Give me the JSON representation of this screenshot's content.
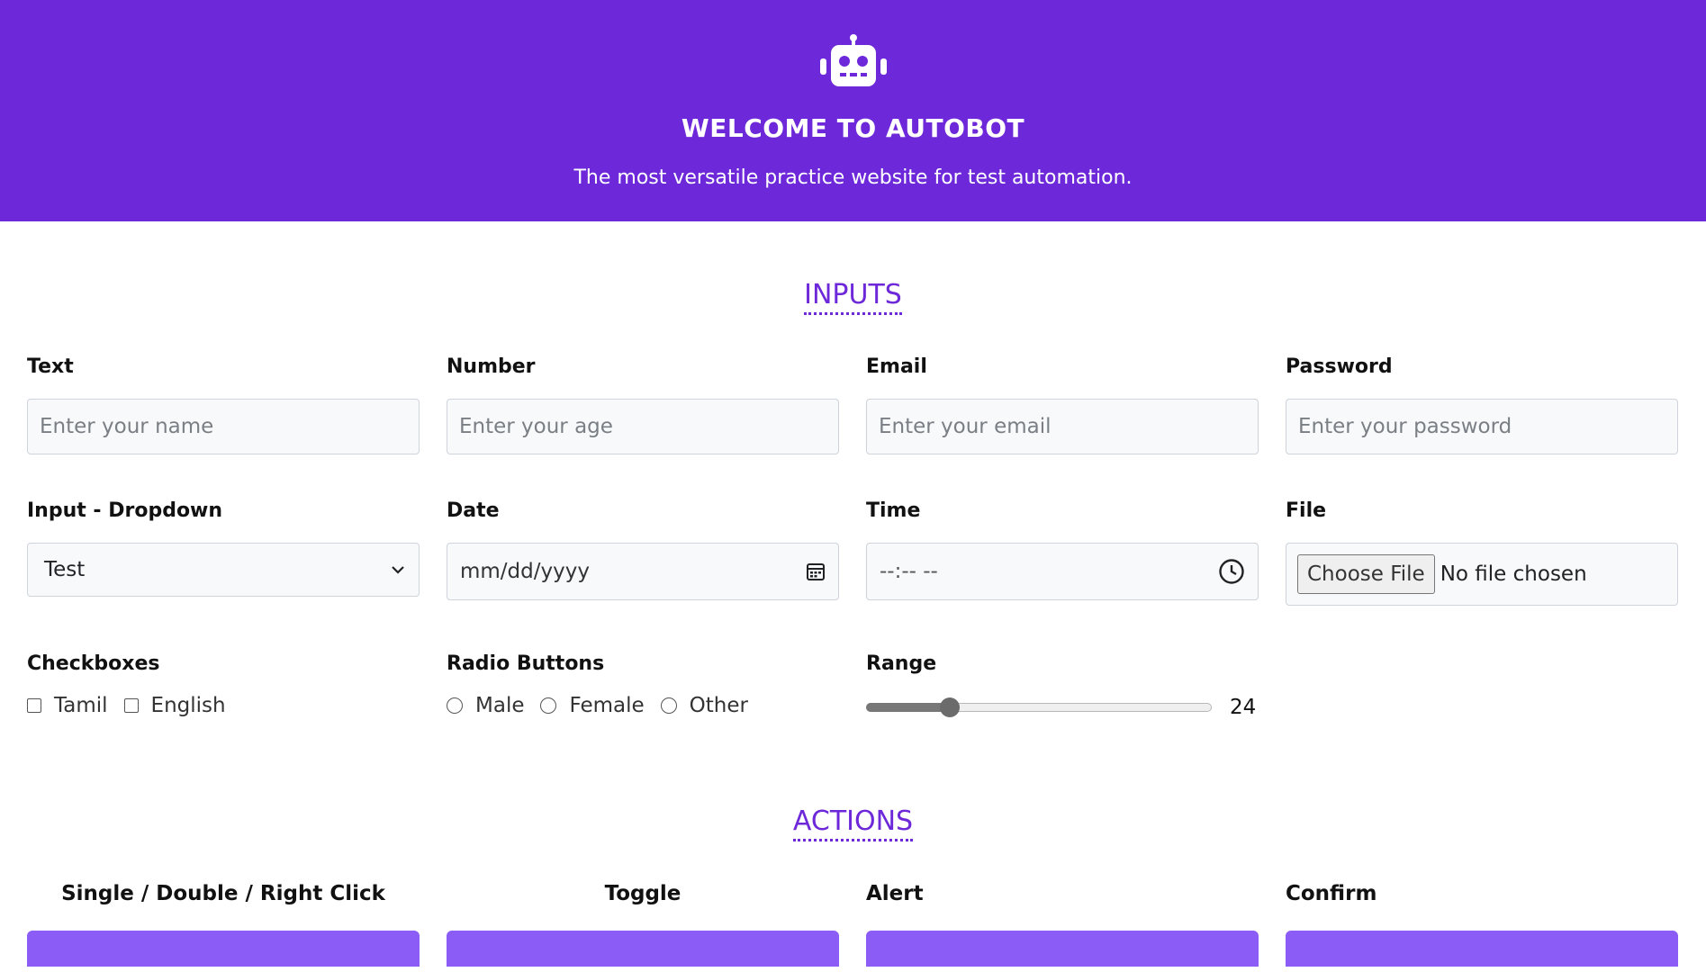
{
  "header": {
    "title": "WELCOME TO AUTOBOT",
    "subtitle": "The most versatile practice website for test automation.",
    "logo_icon": "robot-icon"
  },
  "colors": {
    "primary": "#6d28d9",
    "button": "#8b5cf6"
  },
  "inputs_section": {
    "title": "INPUTS",
    "text": {
      "label": "Text",
      "placeholder": "Enter your name"
    },
    "number": {
      "label": "Number",
      "placeholder": "Enter your age"
    },
    "email": {
      "label": "Email",
      "placeholder": "Enter your email"
    },
    "password": {
      "label": "Password",
      "placeholder": "Enter your password"
    },
    "dropdown": {
      "label": "Input - Dropdown",
      "selected": "Test",
      "icon": "chevron-down-icon"
    },
    "date": {
      "label": "Date",
      "value": "mm/dd/yyyy",
      "icon": "calendar-icon"
    },
    "time": {
      "label": "Time",
      "value": "--:-- --",
      "icon": "clock-icon"
    },
    "file": {
      "label": "File",
      "button_label": "Choose File",
      "status": "No file chosen"
    },
    "checkboxes": {
      "label": "Checkboxes",
      "options": [
        "Tamil",
        "English"
      ]
    },
    "radios": {
      "label": "Radio Buttons",
      "options": [
        "Male",
        "Female",
        "Other"
      ]
    },
    "range": {
      "label": "Range",
      "value": "24",
      "fraction": 0.24
    }
  },
  "actions_section": {
    "title": "ACTIONS",
    "items": [
      {
        "label": "Single / Double / Right Click"
      },
      {
        "label": "Toggle"
      },
      {
        "label": "Alert"
      },
      {
        "label": "Confirm"
      }
    ]
  }
}
